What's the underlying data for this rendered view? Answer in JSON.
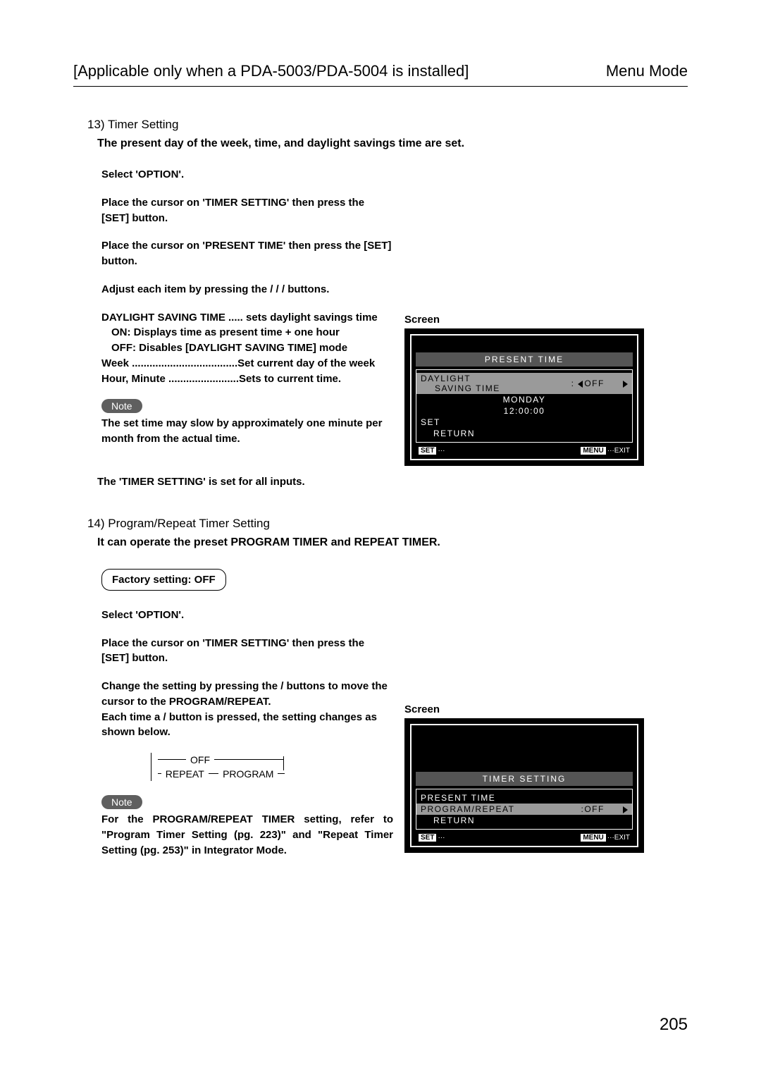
{
  "header": {
    "left": "[Applicable only when a PDA-5003/PDA-5004 is installed]",
    "right": "Menu Mode"
  },
  "section13": {
    "title": "13) Timer Setting",
    "desc": "The present day of the week, time, and daylight savings time are set.",
    "p1": "Select 'OPTION'.",
    "p2": "Place the cursor on 'TIMER SETTING' then press the [SET] button.",
    "p3": "Place the cursor on 'PRESENT TIME' then press the [SET] button.",
    "p4": "Adjust each item by pressing the / / / buttons.",
    "dst_line": "DAYLIGHT SAVING TIME ..... sets daylight savings time",
    "dst_on": "ON: Displays time as present time + one hour",
    "dst_off": "OFF: Disables [DAYLIGHT SAVING TIME] mode",
    "week_line": "Week ....................................Set current day of the week",
    "hm_line": "Hour, Minute ........................Sets to current time.",
    "note_label": "Note",
    "note_body": "The set time may slow by approximately one minute per month from the actual time.",
    "tail": "The 'TIMER SETTING' is set for all inputs.",
    "screen_label": "Screen",
    "osd": {
      "title": "PRESENT TIME",
      "daylight_l1": "DAYLIGHT",
      "daylight_l2": "SAVING TIME",
      "daylight_val": "OFF",
      "day": "MONDAY",
      "time": "12:00:00",
      "set": "SET",
      "return": "RETURN",
      "footer_left_tag": "SET",
      "footer_left_dots": "···",
      "footer_right_tag": "MENU",
      "footer_right_text": "···EXIT"
    }
  },
  "section14": {
    "title": "14) Program/Repeat Timer Setting",
    "desc": "It can operate the preset PROGRAM TIMER and REPEAT TIMER.",
    "factory": "Factory setting: OFF",
    "p1": "Select 'OPTION'.",
    "p2": "Place the cursor on 'TIMER SETTING' then press the [SET] button.",
    "p3": "Change the setting by pressing the / buttons to move the cursor to the PROGRAM/REPEAT.",
    "p4": "Each time a / button is pressed, the setting changes as shown below.",
    "diagram": {
      "off": "OFF",
      "repeat": "REPEAT",
      "program": "PROGRAM"
    },
    "note_label": "Note",
    "note_body": "For the PROGRAM/REPEAT TIMER setting, refer to \"Program Timer Setting (pg. 223)\" and \"Repeat Timer Setting (pg. 253)\" in Integrator Mode.",
    "screen_label": "Screen",
    "osd": {
      "title": "TIMER SETTING",
      "present": "PRESENT TIME",
      "progrepeat": "PROGRAM/REPEAT",
      "progrepeat_val": ":OFF",
      "return": "RETURN",
      "footer_left_tag": "SET",
      "footer_left_dots": "···",
      "footer_right_tag": "MENU",
      "footer_right_text": "···EXIT"
    }
  },
  "page_number": "205"
}
